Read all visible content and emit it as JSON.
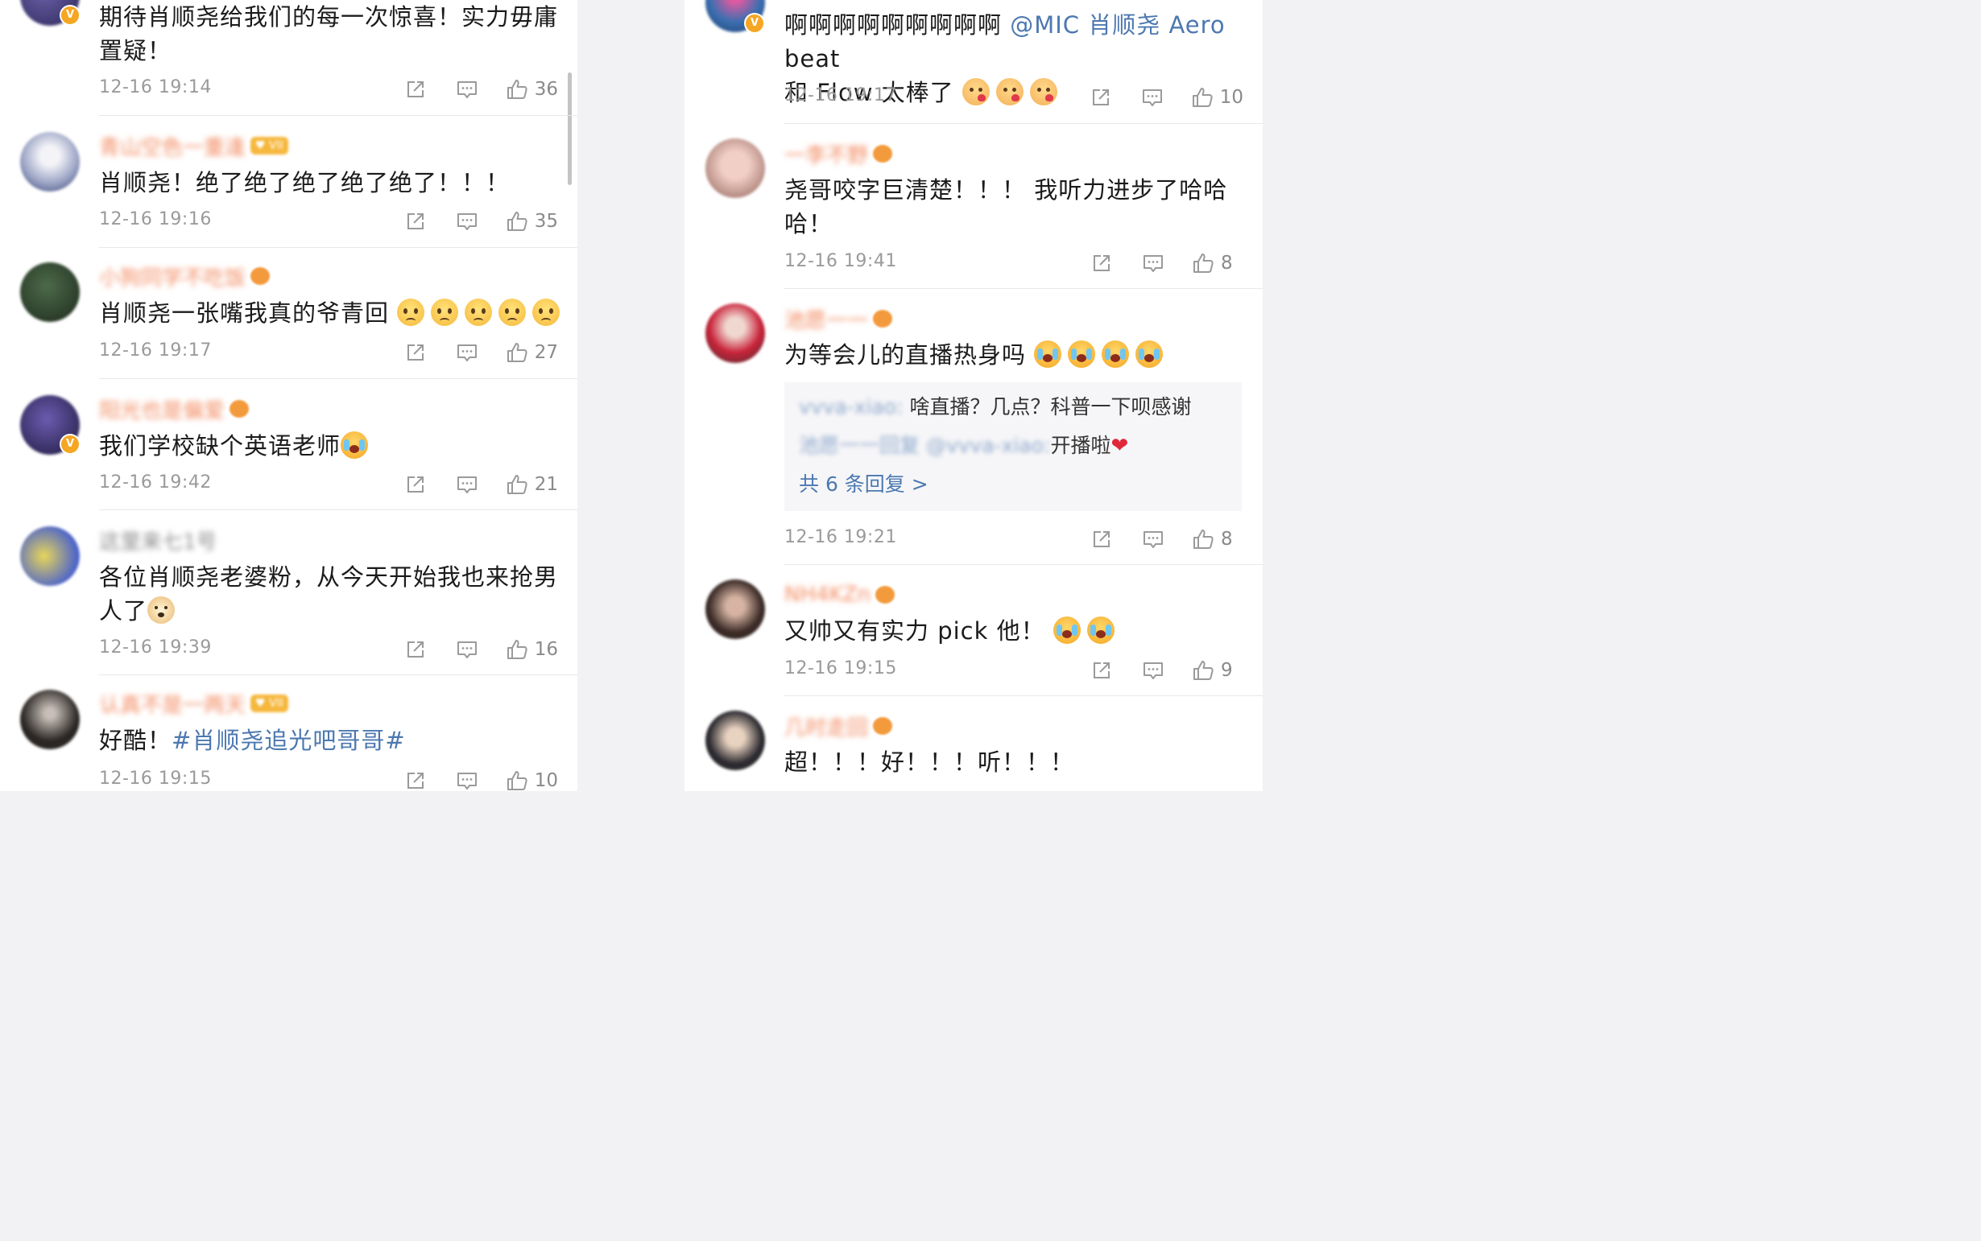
{
  "left": {
    "comments": [
      {
        "text": "期待肖顺尧给我们的每一次惊喜！实力毋庸置疑！",
        "time": "12-16 19:14",
        "likes": "36"
      },
      {
        "username": "青山空色一重逢",
        "text": "肖顺尧！绝了绝了绝了绝了绝了！！！",
        "time": "12-16 19:16",
        "likes": "35"
      },
      {
        "username": "小狗同学不吃饭",
        "text": "肖顺尧一张嘴我真的爷青回",
        "time": "12-16 19:17",
        "likes": "27"
      },
      {
        "username": "阳光也是偏爱",
        "text": "我们学校缺个英语老师",
        "time": "12-16 19:42",
        "likes": "21"
      },
      {
        "username": "这里来七1号",
        "text_line1": "各位肖顺尧老婆粉，从今天开始我也来抢男",
        "text_line2": "人了",
        "time": "12-16 19:39",
        "likes": "16"
      },
      {
        "username": "认真不是一两天",
        "text_prefix": "好酷！",
        "hashtag": "#肖顺尧追光吧哥哥#",
        "time": "12-16 19:15",
        "likes": "10"
      }
    ]
  },
  "right": {
    "comments": [
      {
        "text_prefix": "啊啊啊啊啊啊啊啊啊 ",
        "mention": "@MIC 肖顺尧 Aero",
        "text_suffix": " beat",
        "text_line2": "和 Flow 太棒了",
        "time": "12-16 19:17",
        "likes": "10"
      },
      {
        "username": "一李不野",
        "text_line1": "尧哥咬字巨清楚！！！ 我听力进步了哈哈",
        "text_line2": "哈！",
        "time": "12-16 19:41",
        "likes": "8"
      },
      {
        "username": "池愿一一",
        "text": "为等会儿的直播热身吗",
        "reply1_user": "vvva-xiao:",
        "reply1_text": " 啥直播？几点？科普一下呗感谢",
        "reply2_user": "池愿一一回复 @vvva-xiao:",
        "reply2_text": "开播啦",
        "more_replies": "共 6 条回复 >",
        "time": "12-16 19:21",
        "likes": "8"
      },
      {
        "username": "NH4KZn",
        "text": "又帅又有实力 pick 他！",
        "time": "12-16 19:15",
        "likes": "9"
      },
      {
        "username": "几时走回",
        "text": "超！！！好！！！听！！！"
      }
    ]
  },
  "icons": {
    "share": "share-icon",
    "comment": "comment-icon",
    "like": "thumbs-up-icon",
    "verified": "verified-badge-icon"
  },
  "badges": {
    "verified": "V"
  },
  "colors": {
    "hashtag": "#4c78b0",
    "username_blurred": "#f28a60",
    "verified_badge": "#f5a623",
    "meta_text": "#9a9a9a"
  }
}
